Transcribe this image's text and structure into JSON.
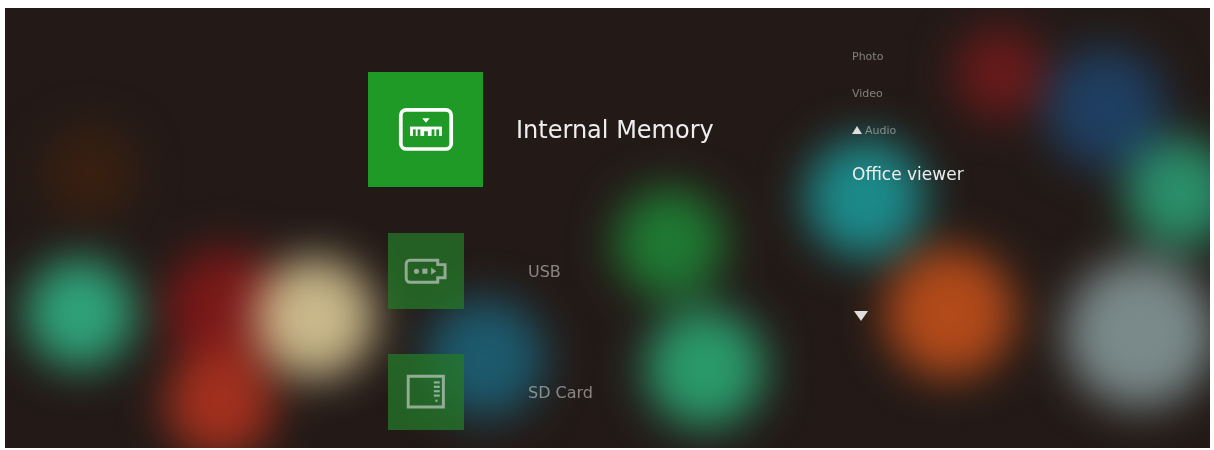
{
  "storage": [
    {
      "kind": "memory",
      "label": "Internal Memory",
      "selected": true
    },
    {
      "kind": "usb",
      "label": "USB",
      "selected": false
    },
    {
      "kind": "sd",
      "label": "SD Card",
      "selected": false
    }
  ],
  "categories": [
    {
      "label": "Photo",
      "selected": false
    },
    {
      "label": "Video",
      "selected": false
    },
    {
      "label": "Audio",
      "selected": false
    },
    {
      "label": "Office viewer",
      "selected": true
    }
  ]
}
